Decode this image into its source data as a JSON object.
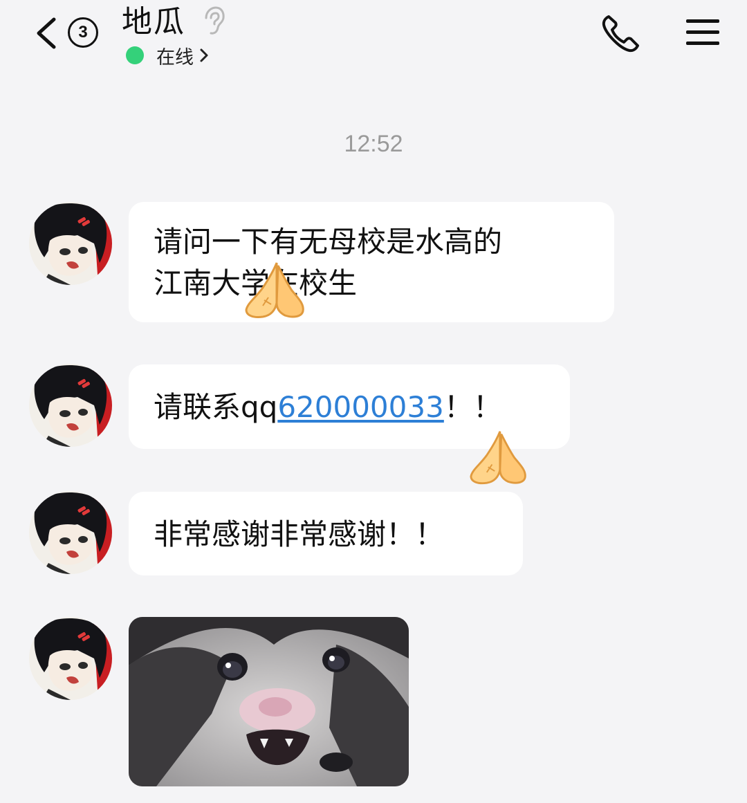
{
  "header": {
    "back_icon": "chevron-left-icon",
    "unread_count": "3",
    "contact_name": "地瓜",
    "ear_icon": "ear-icon",
    "status_text": "在线",
    "status_color": "#34d17a",
    "call_icon": "phone-icon",
    "menu_icon": "hamburger-menu-icon"
  },
  "conversation": {
    "timestamp": "12:52",
    "messages": [
      {
        "type": "text",
        "text": "请问一下有无母校是水高的\n江南大学在校生"
      },
      {
        "type": "text",
        "prefix": "请联系qq",
        "link": "620000033",
        "suffix": "！！",
        "link_color": "#2d7fd6"
      },
      {
        "type": "text",
        "text": "非常感谢非常感谢！！"
      },
      {
        "type": "image",
        "description": "crying-cat-meme-image"
      }
    ]
  },
  "theme": {
    "background": "#f4f4f6",
    "bubble": "#ffffff",
    "timestamp_color": "#9a9a9a"
  }
}
